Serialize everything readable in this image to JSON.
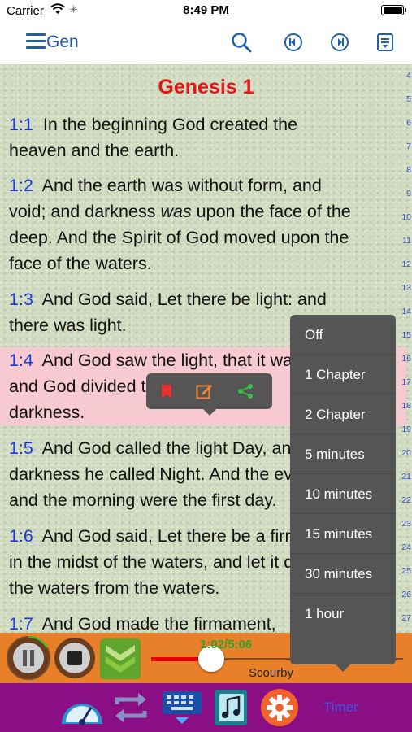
{
  "status_bar": {
    "carrier": "Carrier",
    "time": "8:49 PM"
  },
  "nav": {
    "book": "Gen"
  },
  "chapter": {
    "title": "Genesis 1"
  },
  "side_index": [
    "4",
    "5",
    "6",
    "7",
    "8",
    "9",
    "10",
    "11",
    "12",
    "13",
    "14",
    "15",
    "16",
    "17",
    "18",
    "19",
    "20",
    "21",
    "22",
    "23",
    "24",
    "25",
    "26",
    "27"
  ],
  "verses": [
    {
      "num": "1:1",
      "lines": [
        "In the beginning God created the",
        "heaven and the earth."
      ]
    },
    {
      "num": "1:2",
      "lines": [
        "And the earth was without form, and",
        "void; and darkness was upon the face of the",
        "deep. And the Spirit of God moved upon the",
        "face of the waters."
      ]
    },
    {
      "num": "1:3",
      "lines": [
        "And God said, Let there be light: and",
        "there was light."
      ]
    },
    {
      "num": "1:4",
      "lines": [
        "And God saw the light, that it was good:",
        "and God divided the light from the",
        "darkness."
      ]
    },
    {
      "num": "1:5",
      "lines": [
        "And God called the light Day, and the",
        "darkness he called Night. And the evening",
        "and the morning were the first day."
      ]
    },
    {
      "num": "1:6",
      "lines": [
        "And God said, Let there be a firmament",
        "in the midst of the waters, and let it divide",
        "the waters from the waters."
      ]
    },
    {
      "num": "1:7",
      "lines": [
        "And God made the firmament,"
      ]
    }
  ],
  "timer_menu": {
    "options": [
      "Off",
      "1 Chapter",
      "2 Chapter",
      "5 minutes",
      "10 minutes",
      "15 minutes",
      "30 minutes",
      "1 hour"
    ]
  },
  "player": {
    "time": "1:02/5:06",
    "reader": "Scourby",
    "progress": 0.24
  },
  "toolbar": {
    "timer_label": "Timer"
  },
  "colors": {
    "accent": "#1f5ea8",
    "verse_number": "#1a39d6",
    "chapter_title": "#e0161b",
    "highlight": "#f6cad0",
    "player_bar": "#e8802a",
    "toolbar": "#8a0f84"
  }
}
